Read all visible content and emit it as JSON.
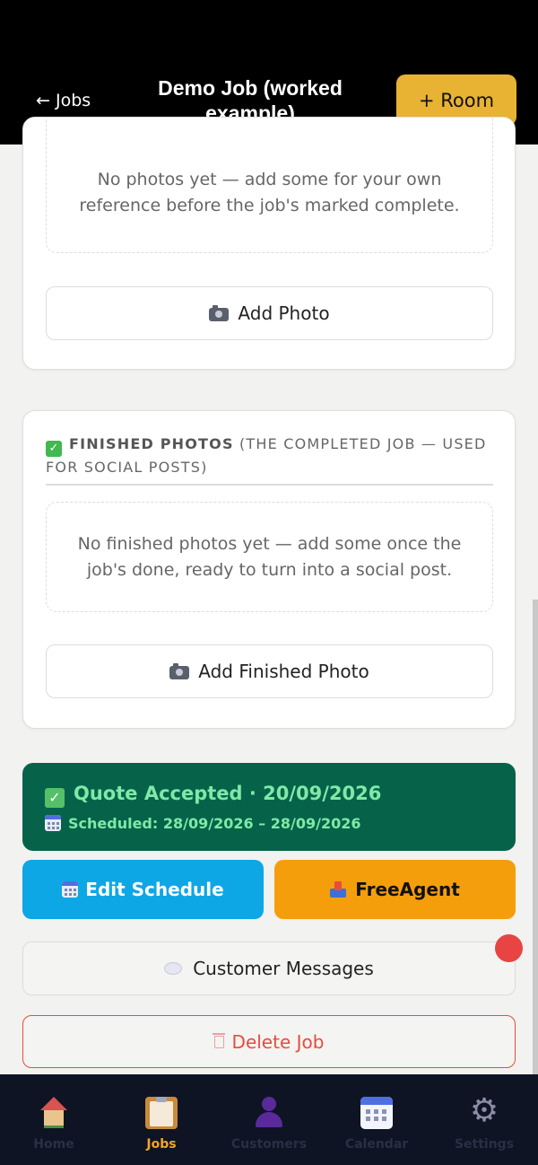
{
  "header": {
    "back_label": "← Jobs",
    "title": "Demo Job (worked example)",
    "add_room_label": "+ Room"
  },
  "reference_photos": {
    "empty_text": "No photos yet — add some for your own reference before the job's marked complete.",
    "add_button_label": "Add Photo"
  },
  "finished_photos": {
    "heading_bold": "FINISHED PHOTOS",
    "heading_rest": " (THE COMPLETED JOB — USED FOR SOCIAL POSTS)",
    "empty_text": "No finished photos yet — add some once the job's done, ready to turn into a social post.",
    "add_button_label": "Add Finished Photo"
  },
  "quote_status": {
    "title": "Quote Accepted · 20/09/2026",
    "scheduled": "Scheduled: 28/09/2026 – 28/09/2026",
    "color": "#06634a",
    "text_color": "#7fe9a6"
  },
  "actions": {
    "edit_schedule_label": "Edit Schedule",
    "freeagent_label": "FreeAgent",
    "customer_messages_label": "Customer Messages",
    "delete_job_label": "Delete Job"
  },
  "bottom_nav": {
    "items": [
      {
        "label": "Home",
        "icon": "home-icon",
        "active": false
      },
      {
        "label": "Jobs",
        "icon": "clipboard-icon",
        "active": true
      },
      {
        "label": "Customers",
        "icon": "person-icon",
        "active": false
      },
      {
        "label": "Calendar",
        "icon": "calendar-icon",
        "active": false
      },
      {
        "label": "Settings",
        "icon": "gear-icon",
        "active": false
      }
    ]
  },
  "colors": {
    "accent": "#e8b232",
    "active_nav": "#f5a623",
    "danger": "#e74c3c",
    "edit_schedule": "#0ea7e6",
    "freeagent": "#f59e0b"
  }
}
